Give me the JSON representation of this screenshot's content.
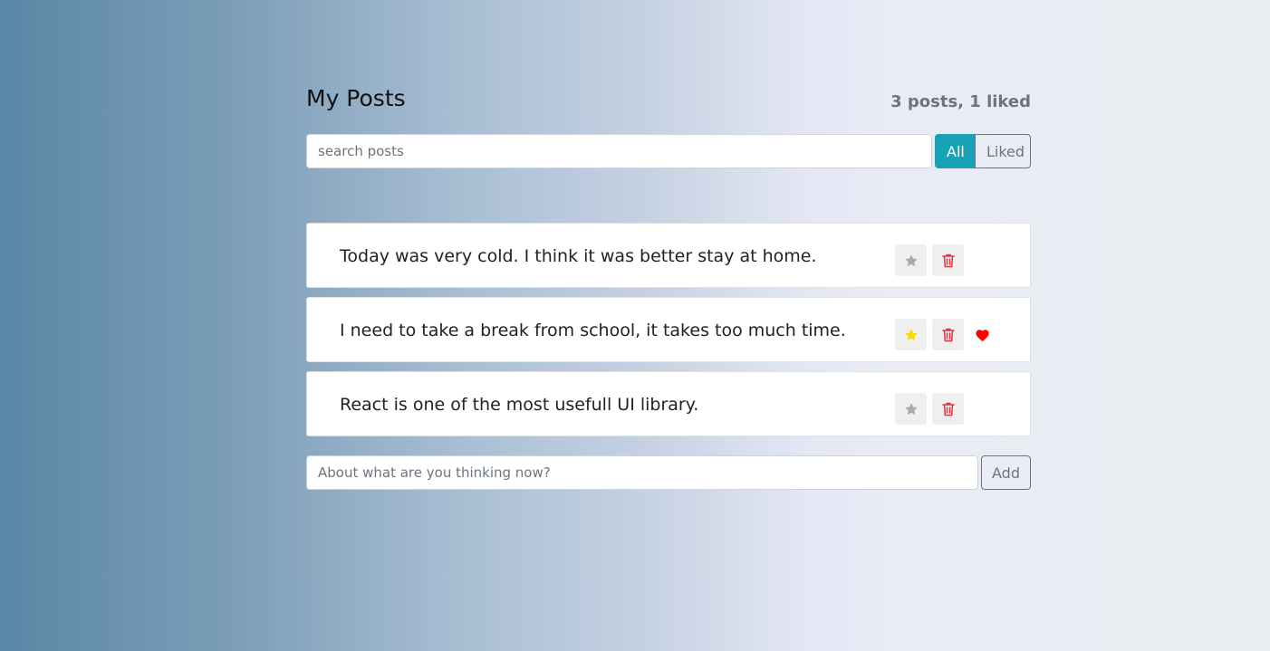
{
  "header": {
    "title": "My Posts",
    "counter": "3 posts, 1 liked"
  },
  "search": {
    "placeholder": "search posts",
    "value": ""
  },
  "filter": {
    "all_label": "All",
    "liked_label": "Liked",
    "active": "All"
  },
  "posts": [
    {
      "text": "Today was very cold. I think it was better stay at home.",
      "important": false,
      "liked": false
    },
    {
      "text": "I need to take a break from school, it takes too much time.",
      "important": true,
      "liked": true
    },
    {
      "text": "React is one of the most usefull UI library.",
      "important": false,
      "liked": false
    }
  ],
  "add_form": {
    "placeholder": "About what are you thinking now?",
    "button_label": "Add"
  },
  "icons": {
    "star": "star-icon",
    "trash": "trash-icon",
    "heart": "heart-icon"
  },
  "colors": {
    "accent": "#17a2b8",
    "star_active": "#ffd700",
    "star_inactive": "#a9a9a9",
    "trash": "#dc3545",
    "heart": "#ff0000"
  }
}
